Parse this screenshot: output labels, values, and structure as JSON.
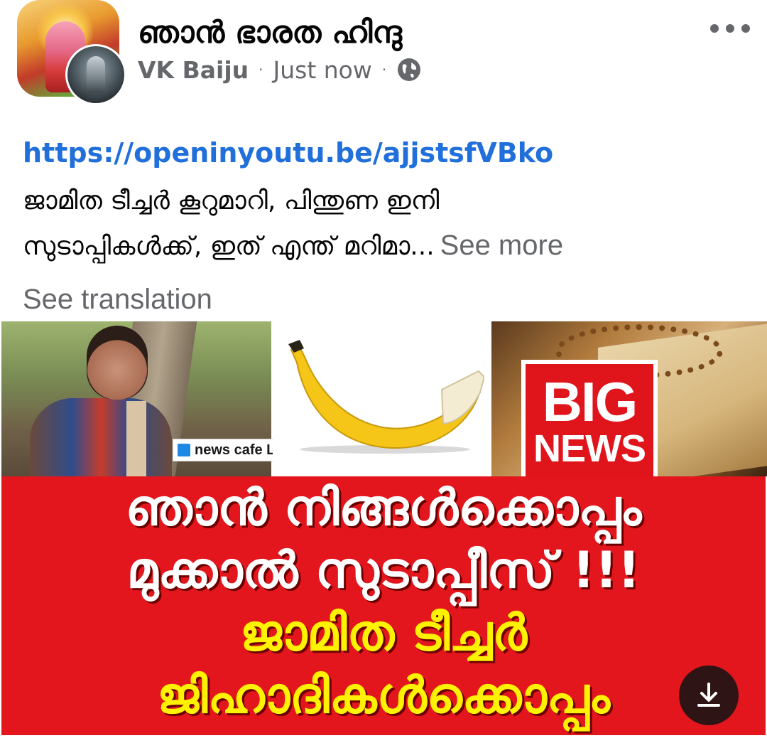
{
  "header": {
    "group_name": "ഞാൻ ഭാരത ഹിന്ദു",
    "author": "VK Baiju",
    "separator": "·",
    "timestamp": "Just now",
    "privacy_icon": "globe-icon",
    "more_icon": "more-options-icon"
  },
  "body": {
    "link": "https://openinyoutu.be/ajjstsfVBko",
    "text_line1": "ജാമിത ടീച്ചർ കൂറുമാറി, പിന്തുണ ഇനി",
    "text_line2": "സുടാപ്പികൾക്ക്, ഇത് എന്ത് മറിമാ...",
    "see_more": "See more",
    "see_translation": "See translation"
  },
  "thumbnail": {
    "badge_news_cafe": "news cafe LIVE",
    "badge_big": "BIG",
    "badge_news": "NEWS",
    "headline_line1": "ഞാൻ നിങ്ങൾക്കൊപ്പം",
    "headline_line2": "മുക്കാൽ സുടാപ്പീസ് !!!",
    "headline_line3": "ജാമിത ടീച്ചർ",
    "headline_line4": "ജിഹാദികൾക്കൊപ്പം",
    "download_icon": "download-icon"
  },
  "colors": {
    "link": "#216fdb",
    "secondary_text": "#65676b",
    "headline_red": "#e3161d",
    "headline_yellow": "#fff200"
  }
}
